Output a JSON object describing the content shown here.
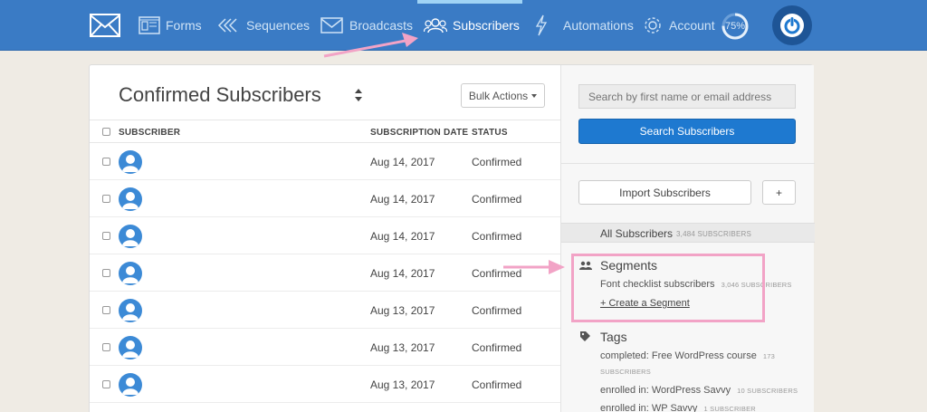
{
  "nav": {
    "items": [
      {
        "label": "Forms",
        "icon": "form-icon"
      },
      {
        "label": "Sequences",
        "icon": "sequences-icon"
      },
      {
        "label": "Broadcasts",
        "icon": "broadcast-icon"
      },
      {
        "label": "Subscribers",
        "icon": "subscribers-icon",
        "active": true
      },
      {
        "label": "Automations",
        "icon": "lightning-icon"
      },
      {
        "label": "Account",
        "icon": "gear-icon"
      }
    ],
    "progress": "75%",
    "progress_value": 0.75
  },
  "list": {
    "title": "Confirmed Subscribers",
    "bulk_actions": "Bulk Actions",
    "columns": {
      "subscriber": "SUBSCRIBER",
      "date": "SUBSCRIPTION DATE",
      "status": "STATUS"
    },
    "rows": [
      {
        "date": "Aug 14, 2017",
        "status": "Confirmed"
      },
      {
        "date": "Aug 14, 2017",
        "status": "Confirmed"
      },
      {
        "date": "Aug 14, 2017",
        "status": "Confirmed"
      },
      {
        "date": "Aug 14, 2017",
        "status": "Confirmed"
      },
      {
        "date": "Aug 13, 2017",
        "status": "Confirmed"
      },
      {
        "date": "Aug 13, 2017",
        "status": "Confirmed"
      },
      {
        "date": "Aug 13, 2017",
        "status": "Confirmed"
      }
    ]
  },
  "sidebar": {
    "search_placeholder": "Search by first name or email address",
    "search_button": "Search Subscribers",
    "import_button": "Import Subscribers",
    "add_button": "+",
    "all_subscribers": {
      "label": "All Subscribers",
      "count": "3,484 SUBSCRIBERS"
    },
    "segments": {
      "title": "Segments",
      "items": [
        {
          "label": "Font checklist subscribers",
          "count": "3,046 SUBSCRIBERS"
        }
      ],
      "create": "+ Create a Segment"
    },
    "tags": {
      "title": "Tags",
      "items": [
        {
          "label": "completed: Free WordPress course",
          "count": "173",
          "count2": "SUBSCRIBERS"
        },
        {
          "label": "enrolled in: WordPress Savvy",
          "count": "10 SUBSCRIBERS"
        },
        {
          "label": "enrolled in: WP Savvy",
          "count": "1 SUBSCRIBER"
        }
      ]
    }
  },
  "colors": {
    "nav_bg": "#3a7bc5",
    "primary_button": "#1e79d0",
    "annotation": "#f2a3c6",
    "avatar": "#3c8ad6"
  }
}
